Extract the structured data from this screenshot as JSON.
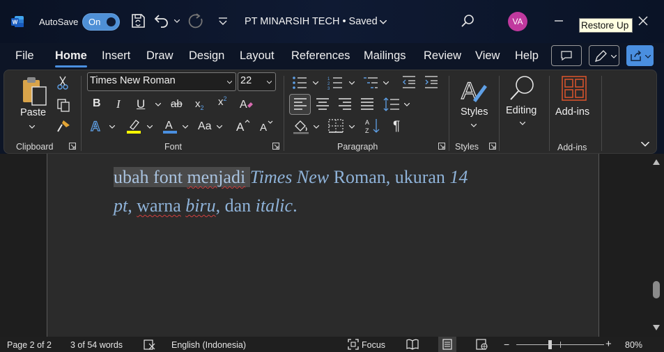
{
  "titlebar": {
    "autosave_label": "AutoSave",
    "autosave_state": "On",
    "document_title": "PT MINARSIH TECH • Saved",
    "avatar_initials": "VA",
    "tooltip": "Restore Up",
    "icons": [
      "word-logo",
      "save-icon",
      "undo-icon",
      "redo-icon",
      "customize-qat-icon",
      "search-icon",
      "minimize-icon",
      "close-icon"
    ]
  },
  "tabs": [
    "File",
    "Home",
    "Insert",
    "Draw",
    "Design",
    "Layout",
    "References",
    "Mailings",
    "Review",
    "View",
    "Help"
  ],
  "active_tab": "Home",
  "ribbon": {
    "clipboard": {
      "label": "Clipboard",
      "paste": "Paste"
    },
    "font": {
      "label": "Font",
      "font_name": "Times New Roman",
      "font_size": "22",
      "change_case": "Aa"
    },
    "paragraph": {
      "label": "Paragraph"
    },
    "styles": {
      "label": "Styles",
      "button": "Styles"
    },
    "editing": {
      "button": "Editing"
    },
    "addins": {
      "label": "Add-ins",
      "button": "Add-ins"
    }
  },
  "document": {
    "line1_selected": "ubah font menjadi ",
    "line1_italic": "Times New",
    "line1_rest": " Roman, ukuran ",
    "line1_italic2": "14",
    "line2_italic": "pt",
    "line2_a": ", ",
    "line2_warna": "warna",
    "line2_b": " ",
    "line2_biru": "biru",
    "line2_c": ", dan ",
    "line2_italic3": "italic",
    "line2_end": "."
  },
  "status": {
    "page": "Page 2 of 2",
    "words": "3 of 54 words",
    "language": "English (Indonesia)",
    "focus": "Focus",
    "zoom": "80%"
  },
  "colors": {
    "accent": "#4a8fe0",
    "avatar": "#c0399e",
    "document_text": "#8fb3d9",
    "highlight_yellow": "#ffff00",
    "font_color_blue": "#4a8fe0"
  }
}
